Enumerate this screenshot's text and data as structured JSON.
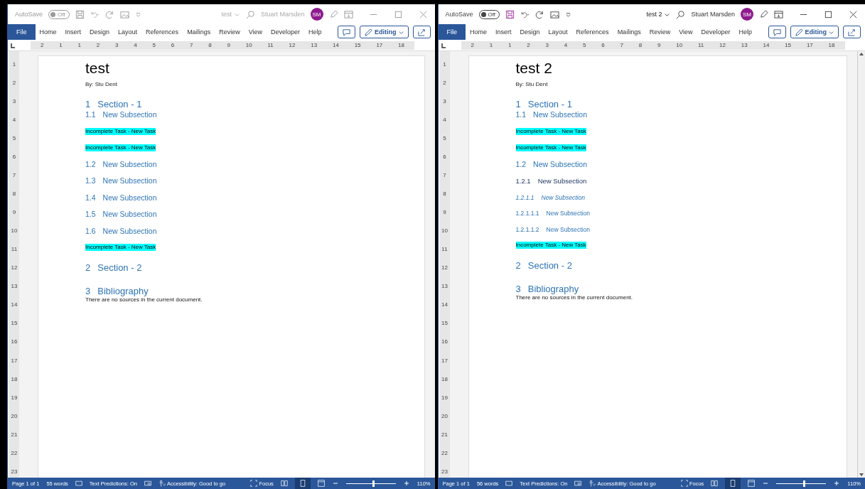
{
  "windows": [
    {
      "active": false,
      "scrollbars": false,
      "autosave": {
        "label": "AutoSave",
        "toggle": "Off"
      },
      "title": "test",
      "user": "Stuart Marsden",
      "avatar": "SM",
      "file_tab": "File",
      "tabs": [
        "Home",
        "Insert",
        "Design",
        "Layout",
        "References",
        "Mailings",
        "Review",
        "View",
        "Developer",
        "Help"
      ],
      "editing": "Editing",
      "ruler_h": [
        "2",
        "1",
        "1",
        "2",
        "3",
        "4",
        "5",
        "6",
        "7",
        "8",
        "9",
        "10",
        "11",
        "12",
        "13",
        "14",
        "15",
        "17",
        "18"
      ],
      "ruler_v": [
        "1",
        "2",
        "3",
        "4",
        "5",
        "6",
        "7",
        "8",
        "9",
        "10",
        "11",
        "12",
        "13",
        "14",
        "15",
        "16",
        "17",
        "18",
        "19",
        "20",
        "21",
        "22",
        "23"
      ],
      "document": [
        {
          "kind": "title",
          "text": "test"
        },
        {
          "kind": "byline",
          "text": "By: Stu Dent"
        },
        {
          "kind": "h1",
          "num": "1",
          "text": "Section - 1"
        },
        {
          "kind": "h2",
          "num": "1.1",
          "text": "New Subsection"
        },
        {
          "kind": "task",
          "text": "Incomplete Task - New Task"
        },
        {
          "kind": "task",
          "text": "Incomplete Task - New Task"
        },
        {
          "kind": "h2",
          "num": "1.2",
          "text": "New Subsection"
        },
        {
          "kind": "h2",
          "num": "1.3",
          "text": "New Subsection"
        },
        {
          "kind": "h2",
          "num": "1.4",
          "text": "New Subsection"
        },
        {
          "kind": "h2",
          "num": "1.5",
          "text": "New Subsection"
        },
        {
          "kind": "h2",
          "num": "1.6",
          "text": "New Subsection"
        },
        {
          "kind": "task",
          "text": "Incomplete Task - New Task"
        },
        {
          "kind": "h1",
          "num": "2",
          "text": "Section - 2"
        },
        {
          "kind": "h1b",
          "num": "3",
          "text": "Bibliography"
        },
        {
          "kind": "body",
          "text": "There are no sources in the current document."
        }
      ],
      "status": {
        "page": "Page 1 of 1",
        "words": "55 words",
        "predictions": "Text Predictions: On",
        "accessibility": "Accessibility: Good to go",
        "focus": "Focus",
        "zoom": "110%"
      },
      "zoom_slider": {
        "level": 0.55
      }
    },
    {
      "active": true,
      "scrollbars": true,
      "autosave": {
        "label": "AutoSave",
        "toggle": "Off"
      },
      "title": "test 2",
      "user": "Stuart Marsden",
      "avatar": "SM",
      "file_tab": "File",
      "tabs": [
        "Home",
        "Insert",
        "Design",
        "Layout",
        "References",
        "Mailings",
        "Review",
        "View",
        "Developer",
        "Help"
      ],
      "editing": "Editing",
      "ruler_h": [
        "2",
        "1",
        "1",
        "2",
        "3",
        "4",
        "5",
        "6",
        "7",
        "8",
        "9",
        "10",
        "11",
        "12",
        "13",
        "14",
        "15",
        "17",
        "18"
      ],
      "ruler_v": [
        "1",
        "2",
        "3",
        "4",
        "5",
        "6",
        "7",
        "8",
        "9",
        "10",
        "11",
        "12",
        "13",
        "14",
        "15",
        "16",
        "17",
        "18",
        "19",
        "20",
        "21",
        "22",
        "23"
      ],
      "document": [
        {
          "kind": "title",
          "text": "test 2"
        },
        {
          "kind": "byline",
          "text": "By: Stu Dent"
        },
        {
          "kind": "h1",
          "num": "1",
          "text": "Section - 1"
        },
        {
          "kind": "h2",
          "num": "1.1",
          "text": "New Subsection"
        },
        {
          "kind": "task",
          "text": "Incomplete Task - New Task"
        },
        {
          "kind": "task",
          "text": "Incomplete Task - New Task"
        },
        {
          "kind": "h2",
          "num": "1.2",
          "text": "New Subsection"
        },
        {
          "kind": "h3",
          "num": "1.2.1",
          "text": "New Subsection"
        },
        {
          "kind": "h4",
          "num": "1.2.1.1",
          "text": "New Subsection"
        },
        {
          "kind": "h5",
          "num": "1.2.1.1.1",
          "text": "New Subsection"
        },
        {
          "kind": "h5",
          "num": "1.2.1.1.2",
          "text": "New Subsection"
        },
        {
          "kind": "task",
          "text": "Incomplete Task - New Task"
        },
        {
          "kind": "h1",
          "num": "2",
          "text": "Section - 2"
        },
        {
          "kind": "h1b",
          "num": "3",
          "text": "Bibliography"
        },
        {
          "kind": "body",
          "text": "There are no sources in the current document."
        }
      ],
      "status": {
        "page": "Page 1 of 1",
        "words": "56 words",
        "predictions": "Text Predictions: On",
        "accessibility": "Accessibility: Good to go",
        "focus": "Focus",
        "zoom": "110%"
      },
      "zoom_slider": {
        "level": 0.55
      }
    }
  ]
}
